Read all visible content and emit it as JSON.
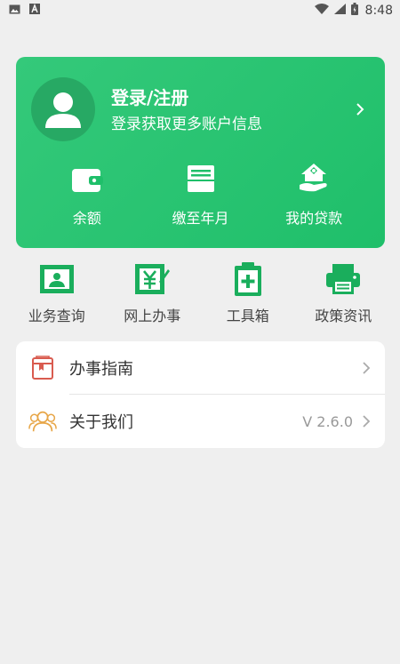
{
  "status_bar": {
    "time": "8:48",
    "icons": [
      "image-icon",
      "text-a-icon",
      "wifi-icon",
      "signal-icon",
      "battery-icon"
    ]
  },
  "profile": {
    "title": "登录/注册",
    "subtitle": "登录获取更多账户信息",
    "actions": [
      {
        "label": "余额",
        "icon": "wallet-icon"
      },
      {
        "label": "缴至年月",
        "icon": "printer-receipt-icon"
      },
      {
        "label": "我的贷款",
        "icon": "house-hand-icon"
      }
    ]
  },
  "quick_entries": [
    {
      "label": "业务查询",
      "icon": "id-card-icon"
    },
    {
      "label": "网上办事",
      "icon": "yen-edit-icon"
    },
    {
      "label": "工具箱",
      "icon": "clipboard-plus-icon"
    },
    {
      "label": "政策资讯",
      "icon": "printer-icon"
    }
  ],
  "menu": {
    "items": [
      {
        "label": "办事指南",
        "icon": "guide-book-icon",
        "value": ""
      },
      {
        "label": "关于我们",
        "icon": "users-icon",
        "value": "V 2.6.0"
      }
    ]
  },
  "colors": {
    "brand_green": "#1fbf6a",
    "icon_green": "#1aae5c",
    "guide_red": "#d95b4f",
    "about_orange": "#e7a648",
    "background": "#efefef"
  }
}
